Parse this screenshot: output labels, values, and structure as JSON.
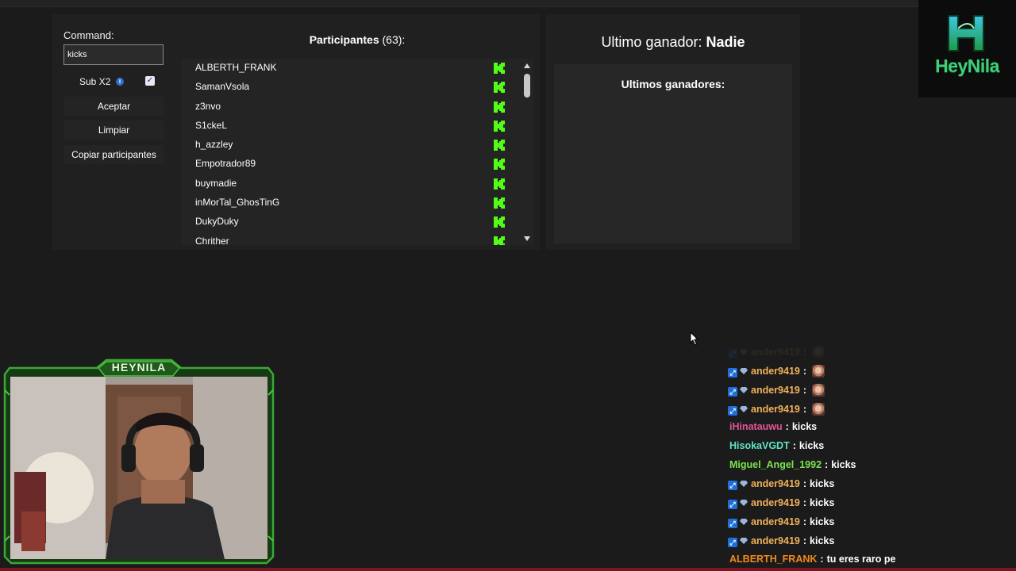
{
  "command": {
    "label": "Command:",
    "value": "kicks"
  },
  "sub_x2": {
    "label": "Sub X2",
    "checked": true
  },
  "buttons": {
    "accept": "Aceptar",
    "clear": "Limpiar",
    "copy": "Copiar participantes"
  },
  "participants": {
    "title": "Participantes",
    "count": "(63):",
    "items": [
      "ALBERTH_FRANK",
      "SamanVsola",
      "z3nvo",
      "S1ckeL",
      "h_azzley",
      "Empotrador89",
      "buymadie",
      "inMorTal_GhosTinG",
      "DukyDuky",
      "Chrither"
    ]
  },
  "winner": {
    "label": "Ultimo ganador:",
    "name": "Nadie"
  },
  "last_winners": {
    "title": "Ultimos ganadores:"
  },
  "logo": {
    "text": "HeyNila"
  },
  "webcam": {
    "label": "HEYNILA"
  },
  "chat": {
    "messages": [
      {
        "user": "ander9419",
        "color": "#f2b15a",
        "badges": true,
        "msg": "",
        "emote": true,
        "faded": true
      },
      {
        "user": "ander9419",
        "color": "#f2b15a",
        "badges": true,
        "msg": "",
        "emote": true
      },
      {
        "user": "ander9419",
        "color": "#f2b15a",
        "badges": true,
        "msg": "",
        "emote": true
      },
      {
        "user": "ander9419",
        "color": "#f2b15a",
        "badges": true,
        "msg": "",
        "emote": true
      },
      {
        "user": "iHinatauwu",
        "color": "#e0569a",
        "badges": false,
        "msg": "kicks"
      },
      {
        "user": "HisokaVGDT",
        "color": "#5fe3c5",
        "badges": false,
        "msg": "kicks"
      },
      {
        "user": "Miguel_Angel_1992",
        "color": "#7be34d",
        "badges": false,
        "msg": "kicks"
      },
      {
        "user": "ander9419",
        "color": "#f2b15a",
        "badges": true,
        "msg": "kicks"
      },
      {
        "user": "ander9419",
        "color": "#f2b15a",
        "badges": true,
        "msg": "kicks"
      },
      {
        "user": "ander9419",
        "color": "#f2b15a",
        "badges": true,
        "msg": "kicks"
      },
      {
        "user": "ander9419",
        "color": "#f2b15a",
        "badges": true,
        "msg": "kicks"
      },
      {
        "user": "ALBERTH_FRANK",
        "color": "#f08a1e",
        "badges": false,
        "msg": "tu eres raro pe"
      }
    ],
    "separator": ":"
  },
  "colors": {
    "kick_green": "#53fc18",
    "frame_green": "#2f8a2a",
    "logo_green": "#3fd07a",
    "accent_blue": "#1e6fd9"
  },
  "icons": [
    "kick-icon",
    "info-icon",
    "checkbox-check",
    "scroll-up-arrow",
    "scroll-down-arrow",
    "prime-badge-icon",
    "gem-badge-icon",
    "mouse-cursor-icon"
  ]
}
